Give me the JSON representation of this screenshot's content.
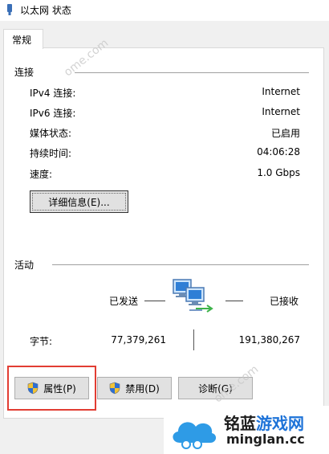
{
  "window": {
    "title": "以太网 状态"
  },
  "tabs": [
    {
      "label": "常规"
    }
  ],
  "connection": {
    "section_label": "连接",
    "rows": [
      {
        "label": "IPv4 连接:",
        "value": "Internet"
      },
      {
        "label": "IPv6 连接:",
        "value": "Internet"
      },
      {
        "label": "媒体状态:",
        "value": "已启用"
      },
      {
        "label": "持续时间:",
        "value": "04:06:28"
      },
      {
        "label": "速度:",
        "value": "1.0 Gbps"
      }
    ],
    "details_button": "详细信息(E)..."
  },
  "activity": {
    "section_label": "活动",
    "sent_label": "已发送",
    "received_label": "已接收",
    "bytes_label": "字节:",
    "bytes_sent": "77,379,261",
    "bytes_received": "191,380,267"
  },
  "buttons": {
    "properties": "属性(P)",
    "disable": "禁用(D)",
    "diagnose": "诊断(G)"
  },
  "watermark": {
    "text": "ome.com",
    "logo_cn_a": "铭蓝",
    "logo_cn_b": "游戏网",
    "logo_en": "minglan.cc"
  },
  "icons": {
    "network-adapter-icon": "network",
    "shield-icon": "uac-shield"
  }
}
